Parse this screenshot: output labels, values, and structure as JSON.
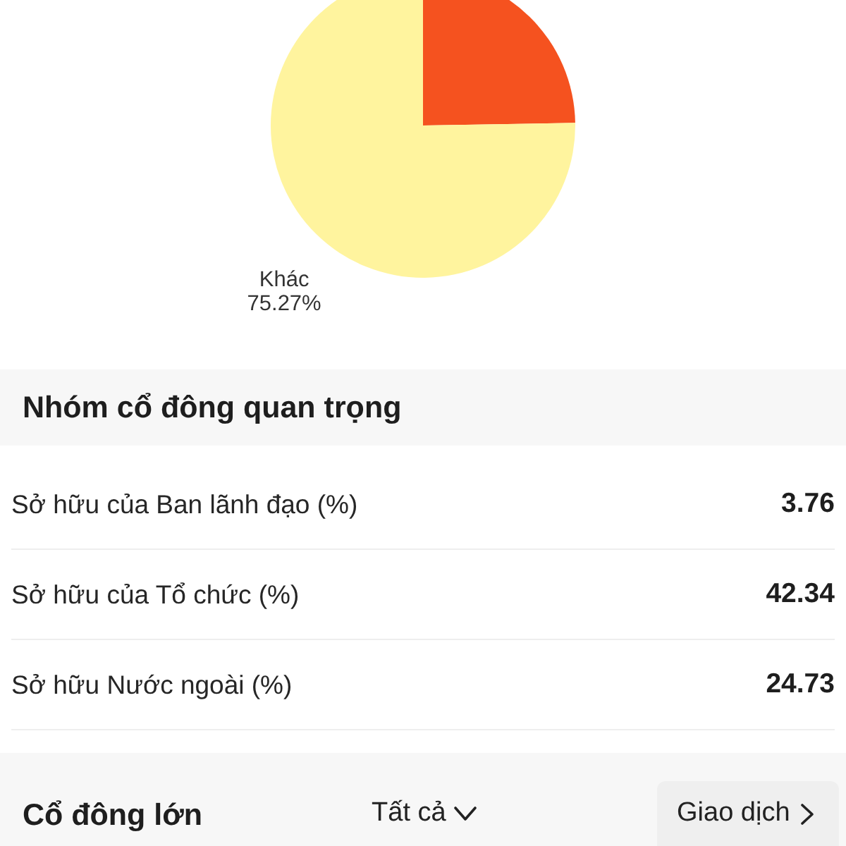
{
  "ownership_chart": {
    "chart_data": {
      "type": "pie",
      "categories": [
        null,
        "Khác"
      ],
      "values": [
        24.73,
        75.27
      ],
      "colors": [
        "#f5521f",
        "#fff49e"
      ],
      "value_labels": [
        null,
        "75.27%"
      ]
    }
  },
  "key_shareholder_groups": {
    "title": "Nhóm cổ đông quan trọng",
    "rows": [
      {
        "label": "Sở hữu của Ban lãnh đạo (%)",
        "value": "3.76"
      },
      {
        "label": "Sở hữu của Tổ chức (%)",
        "value": "42.34"
      },
      {
        "label": "Sở hữu Nước ngoài (%)",
        "value": "24.73"
      }
    ]
  },
  "major_shareholders": {
    "title": "Cổ đông lớn",
    "filter": "Tất cả",
    "link": "Giao dịch"
  }
}
